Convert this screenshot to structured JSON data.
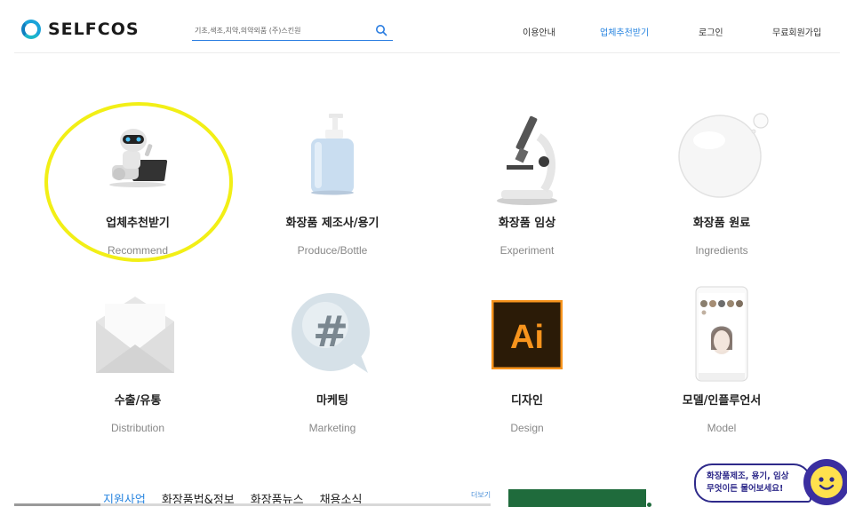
{
  "header": {
    "logo_text": "SELFCOS",
    "search_placeholder": "기초,색조,치약,의약외품 (주)스킨원",
    "nav": [
      "이용안내",
      "업체추천받기",
      "로그인",
      "무료회원가입"
    ],
    "active_nav_index": 1
  },
  "categories": [
    {
      "title": "업체추천받기",
      "subtitle": "Recommend"
    },
    {
      "title": "화장품 제조사/용기",
      "subtitle": "Produce/Bottle"
    },
    {
      "title": "화장품 임상",
      "subtitle": "Experiment"
    },
    {
      "title": "화장품 원료",
      "subtitle": "Ingredients"
    },
    {
      "title": "수출/유통",
      "subtitle": "Distribution"
    },
    {
      "title": "마케팅",
      "subtitle": "Marketing"
    },
    {
      "title": "디자인",
      "subtitle": "Design"
    },
    {
      "title": "모델/인플루언서",
      "subtitle": "Model"
    }
  ],
  "icon_labels": {
    "design": "Ai",
    "marketing": "#"
  },
  "board": {
    "tabs": [
      "지원사업",
      "화장품법&정보",
      "화장품뉴스",
      "채용소식"
    ],
    "active_tab_index": 0,
    "more_label": "더보기"
  },
  "chat": {
    "line1": "화장품제조, 용기, 임상",
    "line2": "무엇이든 물어보세요!"
  },
  "colors": {
    "accent": "#2a86e0",
    "highlight": "#f2ef16",
    "chat": "#2e2a8a",
    "design_icon_bg": "#2b1b07",
    "design_icon_fg": "#f7941d"
  }
}
